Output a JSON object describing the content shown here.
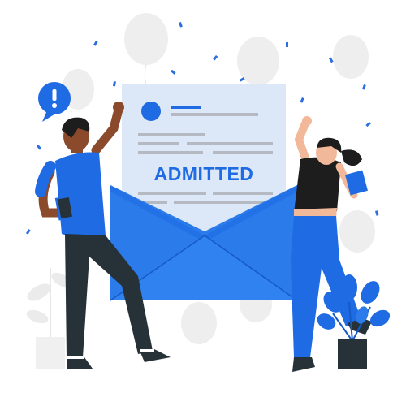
{
  "letter": {
    "status_text": "ADMITTED"
  },
  "colors": {
    "primary_blue": "#1E6BE3",
    "envelope_blue": "#2B7BEA",
    "envelope_dark": "#1659C7",
    "letter_paper": "#DCE7F7",
    "text_lines": "#B5BAC2",
    "skin_dark": "#8A4A2B",
    "skin_light": "#F2B89A",
    "hair_dark": "#1D1D1D",
    "pants_dark": "#263238",
    "balloon_grey": "#EEEEEE",
    "confetti": "#2B6FDE"
  },
  "icons": {
    "alert_badge": "exclamation-icon",
    "plant": "plant-icon"
  }
}
